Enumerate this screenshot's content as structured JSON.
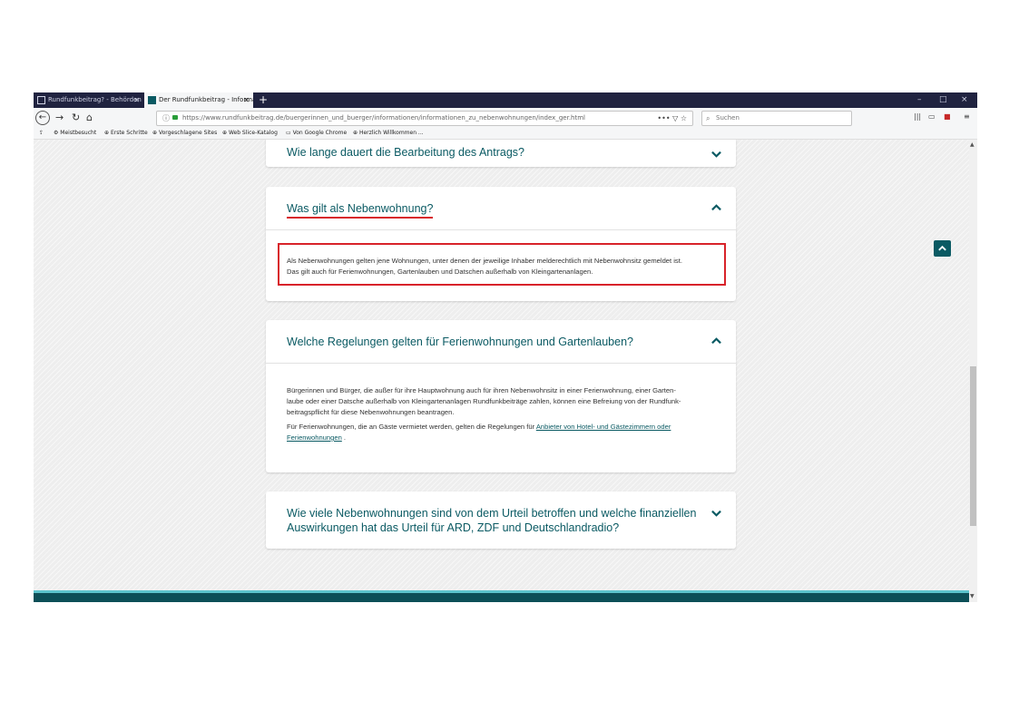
{
  "browser": {
    "tabs": [
      {
        "label": "Rundfunkbeitrag? - Behörden — ...",
        "active": false
      },
      {
        "label": "Der Rundfunkbeitrag - Informa...",
        "active": true
      }
    ],
    "new_tab": "+",
    "window_controls": {
      "minimize": "–",
      "maximize": "□",
      "close": "×"
    },
    "url": "https://www.rundfunkbeitrag.de/buergerinnen_und_buerger/informationen/informationen_zu_nebenwohnungen/index_ger.html",
    "url_actions": "•••  ▽  ☆",
    "search_placeholder": "Suchen",
    "bookmarks": [
      "Meistbesucht",
      "Erste Schritte",
      "Vorgeschlagene Sites",
      "Web Slice-Katalog",
      "Von Google Chrome",
      "Herzlich Willkommen ..."
    ]
  },
  "faq": {
    "item1": {
      "title": "Wie lange dauert die Bearbeitung des Antrags?"
    },
    "item2": {
      "title": "Was gilt als Nebenwohnung?",
      "body_line1": "Als Nebenwohnungen gelten jene Wohnungen, unter denen der jeweilige Inhaber melderechtlich mit Nebenwohnsitz gemeldet ist.",
      "body_line2": "Das gilt auch für Ferienwohnungen, Gartenlauben und Datschen außerhalb von Kleingartenanlagen."
    },
    "item3": {
      "title": "Welche Regelungen gelten für Ferienwohnungen und Gartenlauben?",
      "para1_line1": "Bürgerinnen und Bürger, die außer für ihre Hauptwohnung auch für ihren Nebenwohnsitz in einer Ferienwohnung, einer Garten-",
      "para1_line2": "laube oder einer Datsche außerhalb von Kleingartenanlagen Rundfunkbeiträge zahlen, können eine Befreiung von der Rundfunk-",
      "para1_line3": "beitragspflicht für diese Nebenwohnungen beantragen.",
      "para2_prefix": "Für Ferienwohnungen, die an Gäste vermietet werden, gelten die Regelungen für ",
      "para2_link_line1": "Anbieter von Hotel- und Gästezimmern oder",
      "para2_link_line2": "Ferienwohnungen",
      "para2_suffix": "."
    },
    "item4": {
      "title_line1": "Wie viele Nebenwohnungen sind von dem Urteil betroffen und welche finanziellen",
      "title_line2": "Auswirkungen hat das Urteil für ARD, ZDF und Deutschlandradio?"
    }
  },
  "colors": {
    "accent": "#0a5a63",
    "highlight": "#d8232a",
    "footer": "#0c4f57"
  }
}
